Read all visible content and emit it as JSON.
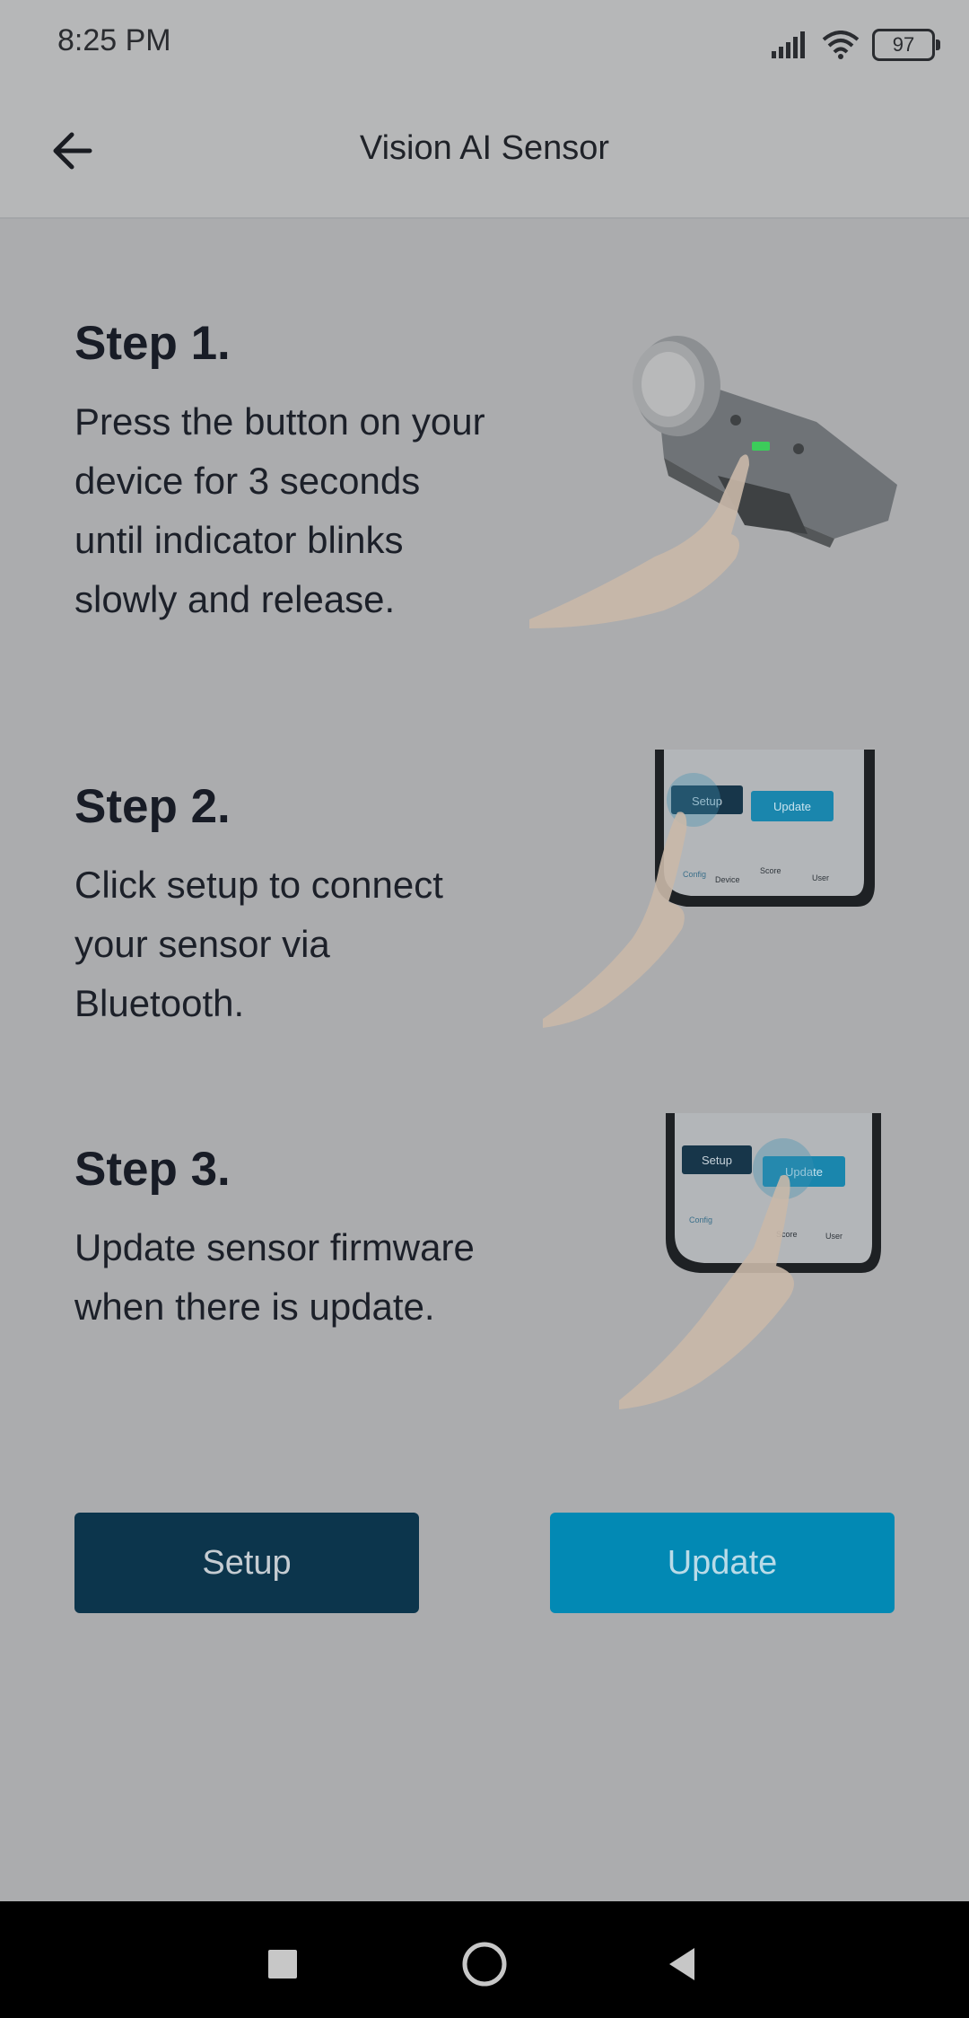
{
  "status_bar": {
    "time": "8:25 PM",
    "battery": "97",
    "icons": [
      "signal-icon",
      "wifi-icon",
      "battery-icon"
    ]
  },
  "app_bar": {
    "title": "Vision AI Sensor",
    "back_icon": "arrow-left-icon"
  },
  "steps": [
    {
      "title": "Step 1.",
      "description": "Press the button on your device for 3 seconds until indicator blinks slowly and release."
    },
    {
      "title": "Step 2.",
      "description": "Click setup to connect your sensor via Bluetooth."
    },
    {
      "title": "Step 3.",
      "description": "Update sensor firmware when there is update."
    }
  ],
  "illustrations": {
    "phone_setup_label": "Setup",
    "phone_update_label": "Update",
    "phone_tabs": [
      "Config",
      "Device",
      "Score",
      "User"
    ]
  },
  "buttons": {
    "setup": "Setup",
    "update": "Update"
  },
  "colors": {
    "background": "#abacae",
    "setup_button": "#0c354c",
    "update_button": "#0289b4",
    "nav_bar": "#000000"
  },
  "nav_bar": {
    "buttons": [
      "square-recents-icon",
      "circle-home-icon",
      "triangle-back-icon"
    ]
  }
}
